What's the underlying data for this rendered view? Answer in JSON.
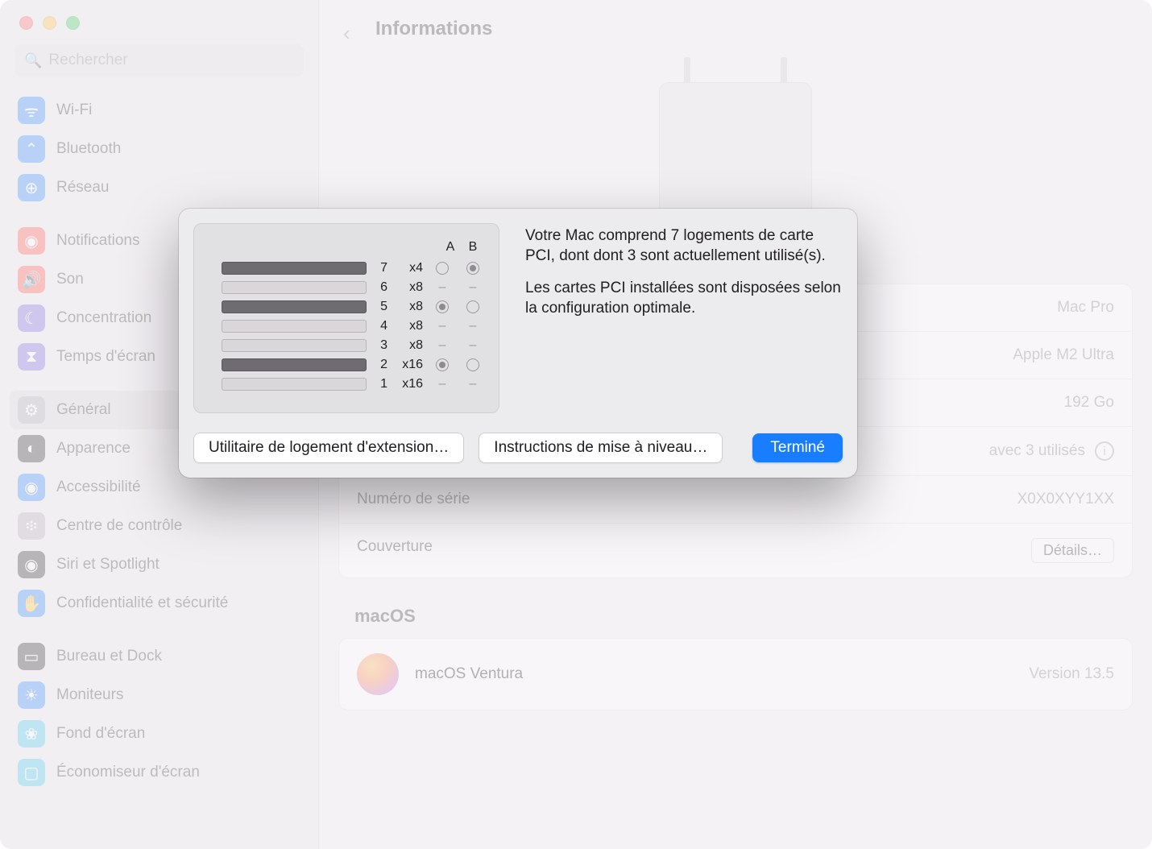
{
  "window": {
    "title": "Informations"
  },
  "search": {
    "placeholder": "Rechercher"
  },
  "sidebar": {
    "groups": [
      [
        {
          "label": "Wi-Fi",
          "icon": "wifi"
        },
        {
          "label": "Bluetooth",
          "icon": "bt"
        },
        {
          "label": "Réseau",
          "icon": "net"
        }
      ],
      [
        {
          "label": "Notifications",
          "icon": "notif"
        },
        {
          "label": "Son",
          "icon": "son"
        },
        {
          "label": "Concentration",
          "icon": "focus"
        },
        {
          "label": "Temps d'écran",
          "icon": "screen"
        }
      ],
      [
        {
          "label": "Général",
          "icon": "gen",
          "selected": true
        },
        {
          "label": "Apparence",
          "icon": "app"
        },
        {
          "label": "Accessibilité",
          "icon": "acc"
        },
        {
          "label": "Centre de contrôle",
          "icon": "cc"
        },
        {
          "label": "Siri et Spotlight",
          "icon": "siri"
        },
        {
          "label": "Confidentialité et sécurité",
          "icon": "priv"
        }
      ],
      [
        {
          "label": "Bureau et Dock",
          "icon": "desk"
        },
        {
          "label": "Moniteurs",
          "icon": "mon"
        },
        {
          "label": "Fond d'écran",
          "icon": "wall"
        },
        {
          "label": "Économiseur d'écran",
          "icon": "saver"
        }
      ]
    ]
  },
  "info": {
    "model_label": "",
    "model": "Mac Pro",
    "chip_label": "",
    "chip": "Apple M2 Ultra",
    "ram_label": "",
    "ram": "192 Go",
    "pci_label": "",
    "pci_used": "avec 3 utilisés",
    "serial_label": "Numéro de série",
    "serial": "X0X0XYY1XX",
    "coverage_label": "Couverture",
    "details_btn": "Détails…"
  },
  "os_section": "macOS",
  "os": {
    "name": "macOS Ventura",
    "version": "Version 13.5"
  },
  "sheet": {
    "cols": {
      "a": "A",
      "b": "B"
    },
    "slots": [
      {
        "num": "7",
        "speed": "x4",
        "filled": true,
        "a": "empty",
        "b": "selected"
      },
      {
        "num": "6",
        "speed": "x8",
        "filled": false,
        "a": "dash",
        "b": "dash"
      },
      {
        "num": "5",
        "speed": "x8",
        "filled": true,
        "a": "selected",
        "b": "empty"
      },
      {
        "num": "4",
        "speed": "x8",
        "filled": false,
        "a": "dash",
        "b": "dash"
      },
      {
        "num": "3",
        "speed": "x8",
        "filled": false,
        "a": "dash",
        "b": "dash"
      },
      {
        "num": "2",
        "speed": "x16",
        "filled": true,
        "a": "selected",
        "b": "empty"
      },
      {
        "num": "1",
        "speed": "x16",
        "filled": false,
        "a": "dash",
        "b": "dash"
      }
    ],
    "p1": "Votre Mac comprend 7 logements de carte PCI, dont dont 3 sont actuellement utilisé(s).",
    "p2": "Les cartes PCI installées sont disposées selon la configuration optimale.",
    "btn_util": "Utilitaire de logement d'extension…",
    "btn_instr": "Instructions de mise à niveau…",
    "btn_done": "Terminé"
  }
}
